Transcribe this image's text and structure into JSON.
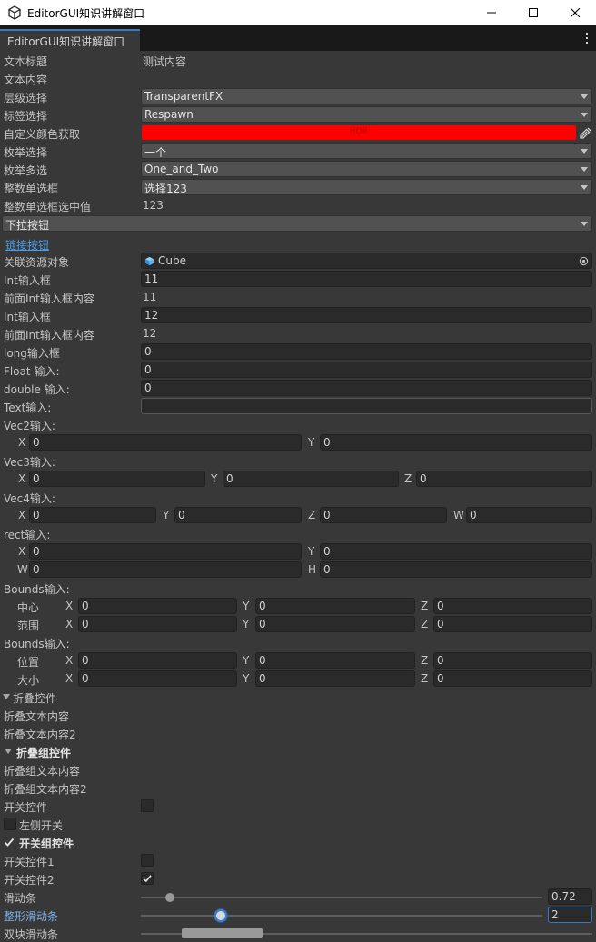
{
  "window": {
    "title": "EditorGUI知识讲解窗口"
  },
  "tab": {
    "label": "EditorGUI知识讲解窗口"
  },
  "rows": {
    "text_title": {
      "label": "文本标题",
      "value": "测试内容"
    },
    "text_content": {
      "label": "文本内容"
    },
    "layer": {
      "label": "层级选择",
      "value": "TransparentFX"
    },
    "tag": {
      "label": "标签选择",
      "value": "Respawn"
    },
    "color": {
      "label": "自定义颜色获取",
      "badge": "HDR",
      "color": "#ff0000"
    },
    "enum_single": {
      "label": "枚举选择",
      "value": "一个"
    },
    "enum_multi": {
      "label": "枚举多选",
      "value": "One_and_Two"
    },
    "int_popup": {
      "label": "整数单选框",
      "value": "选择123"
    },
    "int_popup_value": {
      "label": "整数单选框选中值",
      "value": "123"
    },
    "dropdown_button": {
      "label": "下拉按钮"
    },
    "link_button": {
      "label": "链接按钮"
    },
    "object_field": {
      "label": "关联资源对象",
      "value": "Cube",
      "icon": "cube-icon"
    },
    "int_field1": {
      "label": "Int输入框",
      "value": "11"
    },
    "int_prev1": {
      "label": "前面Int输入框内容",
      "value": "11"
    },
    "int_field2": {
      "label": "Int输入框",
      "value": "12"
    },
    "int_prev2": {
      "label": "前面Int输入框内容",
      "value": "12"
    },
    "long_field": {
      "label": "long输入框",
      "value": "0"
    },
    "float_field": {
      "label": "Float 输入:",
      "value": "0"
    },
    "double_field": {
      "label": "double 输入:",
      "value": "0"
    },
    "text_field": {
      "label": "Text输入:",
      "value": ""
    },
    "vec2": {
      "label": "Vec2输入:",
      "x": "0",
      "y": "0"
    },
    "vec3": {
      "label": "Vec3输入:",
      "x": "0",
      "y": "0",
      "z": "0"
    },
    "vec4": {
      "label": "Vec4输入:",
      "x": "0",
      "y": "0",
      "z": "0",
      "w": "0"
    },
    "rect": {
      "label": "rect输入:",
      "x": "0",
      "y": "0",
      "w": "0",
      "h": "0"
    },
    "bounds1": {
      "label": "Bounds输入:",
      "center": {
        "label": "中心",
        "x": "0",
        "y": "0",
        "z": "0"
      },
      "extent": {
        "label": "范围",
        "x": "0",
        "y": "0",
        "z": "0"
      }
    },
    "bounds2": {
      "label": "Bounds输入:",
      "position": {
        "label": "位置",
        "x": "0",
        "y": "0",
        "z": "0"
      },
      "size": {
        "label": "大小",
        "x": "0",
        "y": "0",
        "z": "0"
      }
    },
    "foldout": {
      "label": "折叠控件",
      "expanded": true
    },
    "foldout_text1": {
      "label": "折叠文本内容"
    },
    "foldout_text2": {
      "label": "折叠文本内容2"
    },
    "foldout_group": {
      "label": "折叠组控件",
      "expanded": true
    },
    "foldout_group_text1": {
      "label": "折叠组文本内容"
    },
    "foldout_group_text2": {
      "label": "折叠组文本内容2"
    },
    "toggle": {
      "label": "开关控件",
      "checked": false
    },
    "toggle_left": {
      "label": "左侧开关",
      "checked": false
    },
    "toggle_group": {
      "label": "开关组控件",
      "checked": true
    },
    "toggle1": {
      "label": "开关控件1",
      "checked": false
    },
    "toggle2": {
      "label": "开关控件2",
      "checked": true
    },
    "slider": {
      "label": "滑动条",
      "value": "0.72",
      "fraction": 0.072
    },
    "int_slider": {
      "label": "整形滑动条",
      "value": "2",
      "fraction": 0.2
    },
    "minmax_slider": {
      "label": "双块滑动条",
      "min_fraction": 0.09,
      "max_fraction": 0.27
    }
  },
  "axes": {
    "x": "X",
    "y": "Y",
    "z": "Z",
    "w": "W",
    "h": "H"
  },
  "colors": {
    "accent": "#3a79bb",
    "link": "#4c9be8",
    "background": "#383838"
  }
}
